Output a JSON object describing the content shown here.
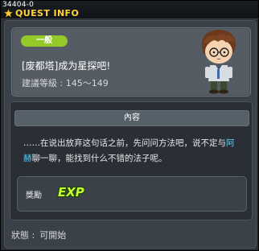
{
  "window": {
    "quest_id": "34404-0",
    "title": "QUEST INFO",
    "accent_color": "#ffd23a"
  },
  "quest": {
    "category": "一般",
    "category_color": "#93c928",
    "name": "[废都塔]成为星探吧!",
    "level_label": "建議等級 : ",
    "level_range": "145～149",
    "npc_icon": "npc-portrait-boy-with-glasses"
  },
  "content": {
    "header": "內容",
    "description_before": "……在说出放弃这句话之前，先问问方法吧，说不定与",
    "npc_name": "阿赫",
    "description_after": "聊一聊，能找到什么不错的法子呢。",
    "npc_link_color": "#4fd1ff"
  },
  "reward": {
    "label": "獎勵",
    "item": "EXP",
    "icon": "exp-icon"
  },
  "status": {
    "label": "狀態 :",
    "value": "可開始"
  }
}
